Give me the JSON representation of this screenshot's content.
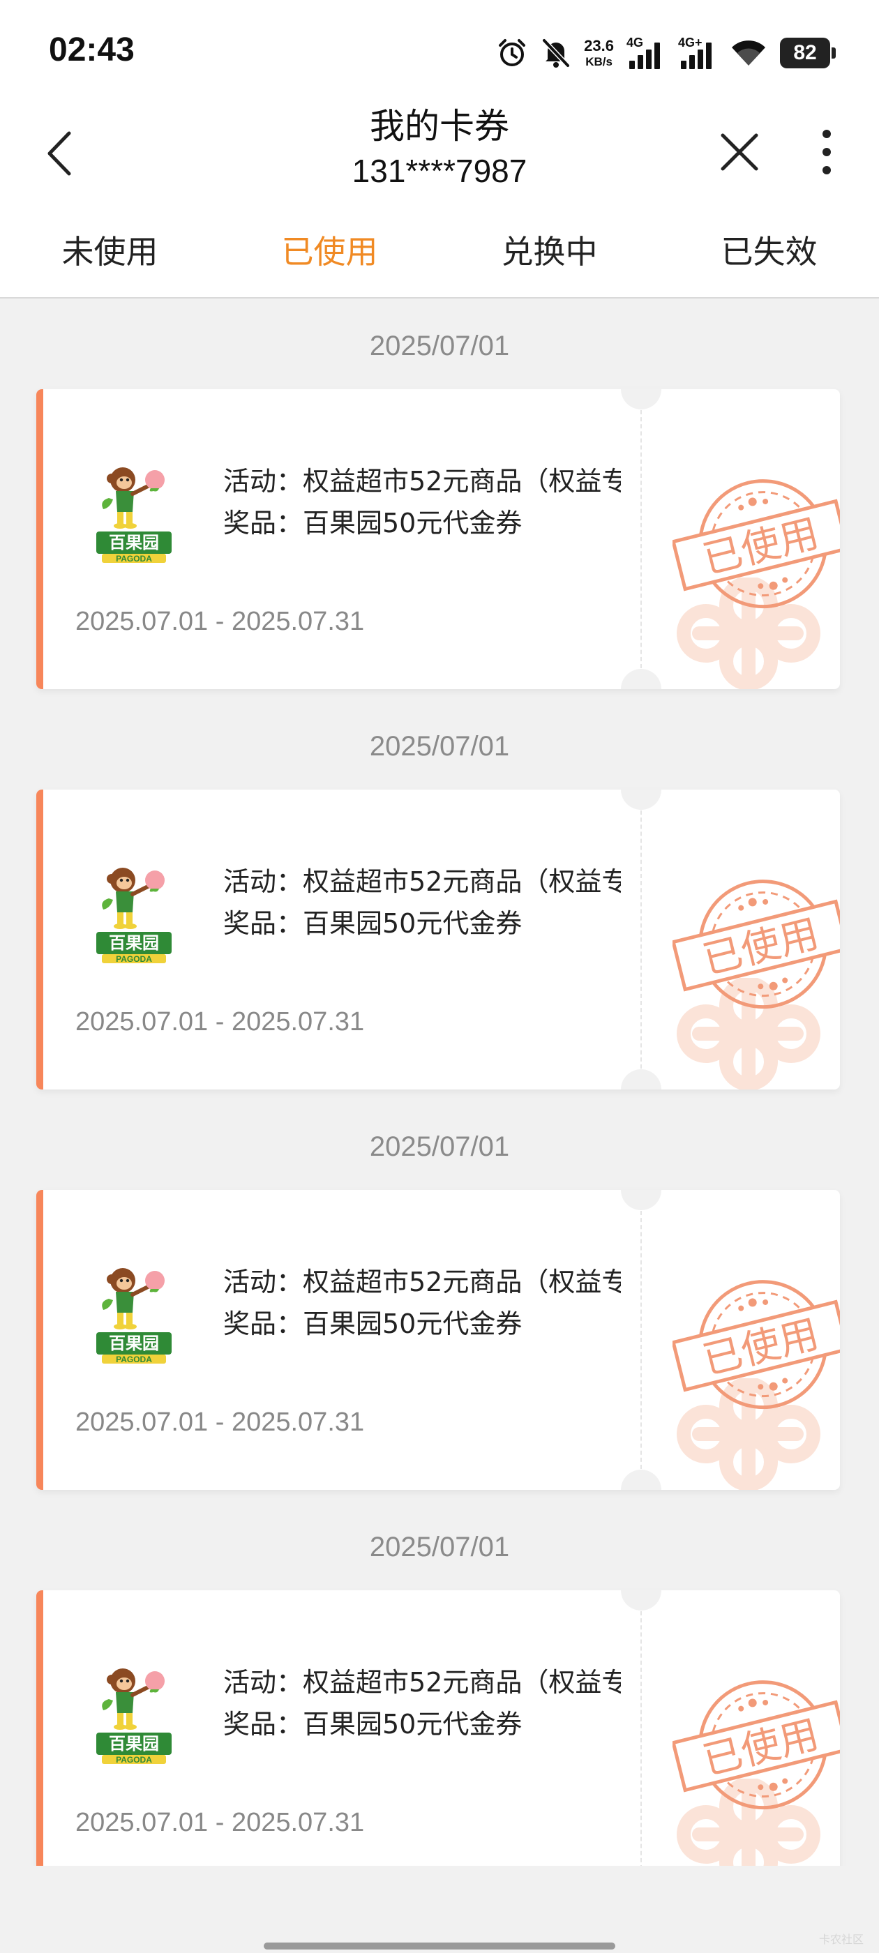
{
  "status_bar": {
    "time": "02:43",
    "net_speed_value": "23.6",
    "net_speed_unit": "KB/s",
    "signal1_label": "4G",
    "signal2_label": "4G+",
    "battery": "82"
  },
  "header": {
    "title": "我的卡券",
    "subtitle": "131****7987"
  },
  "tabs": [
    {
      "label": "未使用",
      "active": false
    },
    {
      "label": "已使用",
      "active": true
    },
    {
      "label": "兑换中",
      "active": false
    },
    {
      "label": "已失效",
      "active": false
    }
  ],
  "coupons": [
    {
      "date": "2025/07/01",
      "logo_text": "百果园",
      "logo_subtext": "PAGODA",
      "activity": "活动：权益超市52元商品（权益专",
      "prize": "奖品：百果园50元代金券",
      "validity": "2025.07.01 - 2025.07.31",
      "stamp": "已使用"
    },
    {
      "date": "2025/07/01",
      "logo_text": "百果园",
      "logo_subtext": "PAGODA",
      "activity": "活动：权益超市52元商品（权益专",
      "prize": "奖品：百果园50元代金券",
      "validity": "2025.07.01 - 2025.07.31",
      "stamp": "已使用"
    },
    {
      "date": "2025/07/01",
      "logo_text": "百果园",
      "logo_subtext": "PAGODA",
      "activity": "活动：权益超市52元商品（权益专",
      "prize": "奖品：百果园50元代金券",
      "validity": "2025.07.01 - 2025.07.31",
      "stamp": "已使用"
    },
    {
      "date": "2025/07/01",
      "logo_text": "百果园",
      "logo_subtext": "PAGODA",
      "activity": "活动：权益超市52元商品（权益专",
      "prize": "奖品：百果园50元代金券",
      "validity": "2025.07.01 - 2025.07.31",
      "stamp": "已使用"
    }
  ],
  "watermark": "卡农社区",
  "colors": {
    "accent": "#f08a24",
    "coupon_stripe": "#f7865a",
    "stamp": "#f29a78"
  }
}
